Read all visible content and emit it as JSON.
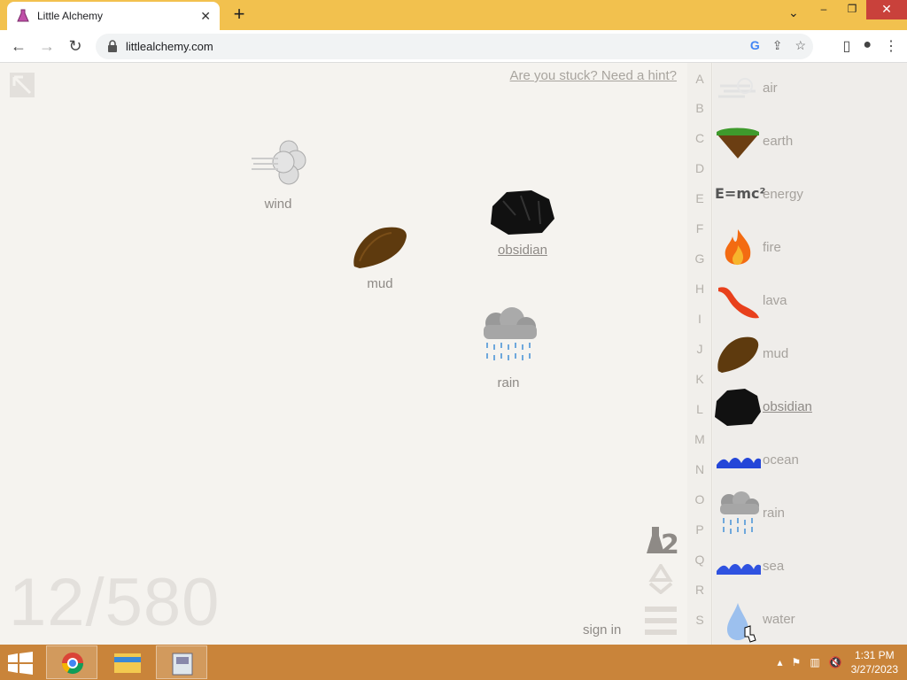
{
  "browser": {
    "tab_title": "Little Alchemy",
    "tab_close": "✕",
    "new_tab": "+",
    "url": "littlealchemy.com",
    "window_controls": {
      "minimize": "–",
      "restore": "❐",
      "close": "✕"
    }
  },
  "game": {
    "hint_text": "Are you stuck? Need a hint?",
    "counter": "12/580",
    "sign_in": "sign in",
    "workspace_elements": [
      {
        "name": "wind",
        "icon": "wind-icon",
        "underlined": false
      },
      {
        "name": "mud",
        "icon": "mud-icon",
        "underlined": false
      },
      {
        "name": "obsidian",
        "icon": "obsidian-icon",
        "underlined": true
      },
      {
        "name": "rain",
        "icon": "rain-icon",
        "underlined": false
      }
    ]
  },
  "alphabet": [
    "A",
    "B",
    "C",
    "D",
    "E",
    "F",
    "G",
    "H",
    "I",
    "J",
    "K",
    "L",
    "M",
    "N",
    "O",
    "P",
    "Q",
    "R",
    "S"
  ],
  "library": [
    {
      "name": "air",
      "icon": "air-icon"
    },
    {
      "name": "earth",
      "icon": "earth-icon"
    },
    {
      "name": "energy",
      "icon": "energy-icon",
      "text_icon": "E=mc²"
    },
    {
      "name": "fire",
      "icon": "fire-icon"
    },
    {
      "name": "lava",
      "icon": "lava-icon"
    },
    {
      "name": "mud",
      "icon": "mud-icon"
    },
    {
      "name": "obsidian",
      "icon": "obsidian-icon",
      "underlined": true
    },
    {
      "name": "ocean",
      "icon": "ocean-icon"
    },
    {
      "name": "rain",
      "icon": "rain-icon"
    },
    {
      "name": "sea",
      "icon": "sea-icon"
    },
    {
      "name": "water",
      "icon": "water-icon"
    }
  ],
  "taskbar": {
    "time": "1:31 PM",
    "date": "3/27/2023"
  },
  "colors": {
    "tab_bar": "#f2c14e",
    "taskbar": "#c9843a",
    "game_bg": "#f5f3ef",
    "label": "#8e8a86"
  }
}
